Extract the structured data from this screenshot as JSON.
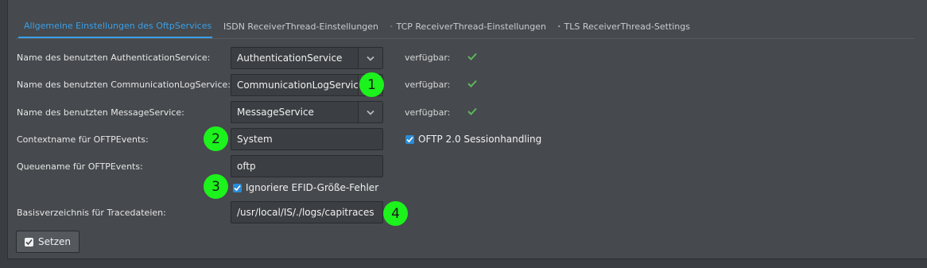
{
  "tabs": [
    {
      "label": "Allgemeine Einstellungen des OftpServices",
      "icon": "wrench-icon",
      "active": true
    },
    {
      "label": "ISDN ReceiverThread-Einstellungen",
      "icon": "phone-icon",
      "active": false
    },
    {
      "label": "TCP ReceiverThread-Einstellungen",
      "icon": "arrows-horizontal-icon",
      "active": false
    },
    {
      "label": "TLS ReceiverThread-Settings",
      "icon": "gear-icon",
      "active": false
    }
  ],
  "form": {
    "auth": {
      "label": "Name des benutzten AuthenticationService:",
      "value": "AuthenticationService",
      "status": "verfügbar:"
    },
    "commlog": {
      "label": "Name des benutzten CommunicationLogService:",
      "value": "CommunicationLogService",
      "status": "verfügbar:"
    },
    "message": {
      "label": "Name des benutzten MessageService:",
      "value": "MessageService",
      "status": "verfügbar:"
    },
    "context": {
      "label": "Contextname für OFTPEvents:",
      "value": "System"
    },
    "session": {
      "label": "OFTP 2.0 Sessionhandling",
      "checked": true
    },
    "queue": {
      "label": "Queuename für OFTPEvents:",
      "value": "oftp"
    },
    "efid": {
      "label": "Ignoriere EFID-Größe-Fehler",
      "checked": true
    },
    "trace": {
      "label": "Basisverzeichnis für Tracedateien:",
      "value": "/usr/local/IS/./logs/capitraces"
    }
  },
  "badges": [
    "1",
    "2",
    "3",
    "4"
  ],
  "submit": {
    "label": "Setzen"
  },
  "colors": {
    "accent": "#3aa0e8",
    "ok": "#5cb85c",
    "badge": "#1cf21c",
    "background": "#46494d"
  }
}
